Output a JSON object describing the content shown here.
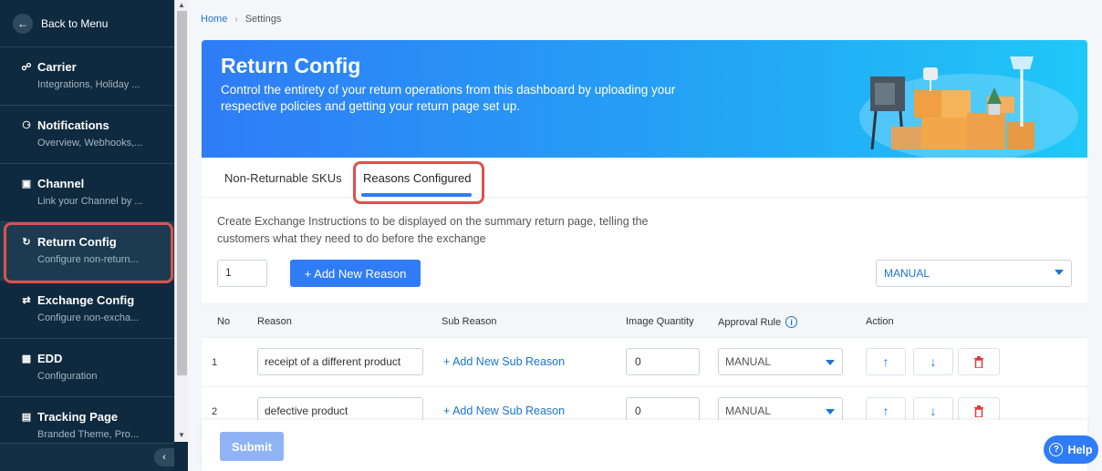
{
  "sidebar": {
    "back_label": "Back to Menu",
    "items": [
      {
        "title": "Carrier",
        "sub": "Integrations, Holiday ...",
        "icon": "carrier-icon"
      },
      {
        "title": "Notifications",
        "sub": "Overview, Webhooks,...",
        "icon": "bell-icon"
      },
      {
        "title": "Channel",
        "sub": "Link your Channel by ...",
        "icon": "store-icon"
      },
      {
        "title": "Return Config",
        "sub": "Configure non-return...",
        "icon": "return-icon"
      },
      {
        "title": "Exchange Config",
        "sub": "Configure non-excha...",
        "icon": "exchange-icon"
      },
      {
        "title": "EDD",
        "sub": "Configuration",
        "icon": "calendar-icon"
      },
      {
        "title": "Tracking Page",
        "sub": "Branded Theme, Pro...",
        "icon": "tracking-icon"
      }
    ],
    "active_index": 3
  },
  "breadcrumb": {
    "home": "Home",
    "current": "Settings"
  },
  "banner": {
    "title": "Return Config",
    "description": "Control the entirety of your return operations from this dashboard by uploading your respective policies and getting your return page set up."
  },
  "tabs": [
    {
      "label": "Non-Returnable SKUs",
      "active": false
    },
    {
      "label": "Reasons Configured",
      "active": true
    }
  ],
  "instructions": "Create Exchange Instructions to be displayed on the summary return page, telling the customers what they need to do before the exchange",
  "controls": {
    "count_value": "1",
    "add_reason_label": "+ Add New Reason",
    "global_rule": "MANUAL"
  },
  "table": {
    "headers": [
      "No",
      "Reason",
      "Sub Reason",
      "Image Quantity",
      "Approval Rule",
      "Action"
    ],
    "rows": [
      {
        "no": "1",
        "reason": "receipt of a different product",
        "sub_link": "+ Add New Sub Reason",
        "qty": "0",
        "rule": "MANUAL"
      },
      {
        "no": "2",
        "reason": "defective product",
        "sub_link": "+ Add New Sub Reason",
        "qty": "0",
        "rule": "MANUAL"
      }
    ]
  },
  "submit_label": "Submit",
  "help_label": "Help",
  "colors": {
    "sidebar": "#0f2a3f",
    "primary": "#2f7cf6",
    "highlight": "#d9534f",
    "danger": "#e53935"
  }
}
